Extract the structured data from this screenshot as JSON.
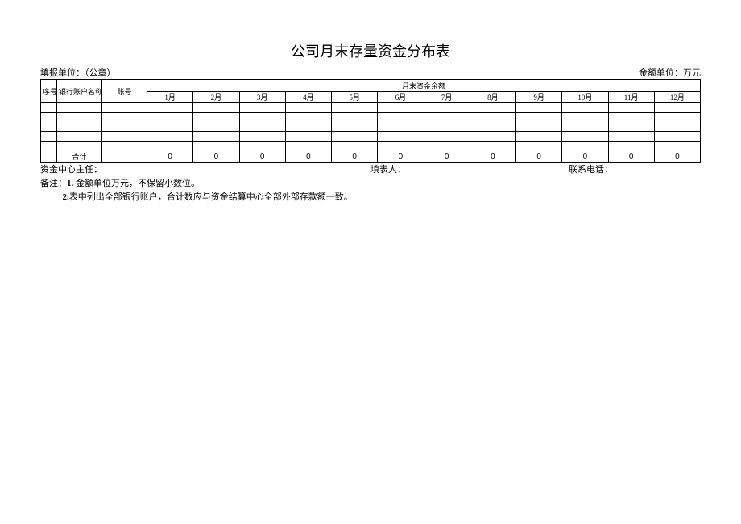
{
  "title": "公司月末存量资金分布表",
  "header": {
    "org_label": "填报单位：（公章）",
    "unit_label": "金额单位：万元"
  },
  "columns": {
    "seq": "序号",
    "bank_name": "银行账户名称",
    "account": "账号",
    "balance_header": "月末资金余额",
    "months": [
      "1月",
      "2月",
      "3月",
      "4月",
      "5月",
      "6月",
      "7月",
      "8月",
      "9月",
      "10月",
      "11月",
      "12月"
    ]
  },
  "rows": [
    {
      "seq": "",
      "name": "",
      "acct": "",
      "vals": [
        "",
        "",
        "",
        "",
        "",
        "",
        "",
        "",
        "",
        "",
        "",
        ""
      ]
    },
    {
      "seq": "",
      "name": "",
      "acct": "",
      "vals": [
        "",
        "",
        "",
        "",
        "",
        "",
        "",
        "",
        "",
        "",
        "",
        ""
      ]
    },
    {
      "seq": "",
      "name": "",
      "acct": "",
      "vals": [
        "",
        "",
        "",
        "",
        "",
        "",
        "",
        "",
        "",
        "",
        "",
        ""
      ]
    },
    {
      "seq": "",
      "name": "",
      "acct": "",
      "vals": [
        "",
        "",
        "",
        "",
        "",
        "",
        "",
        "",
        "",
        "",
        "",
        ""
      ]
    },
    {
      "seq": "",
      "name": "",
      "acct": "",
      "vals": [
        "",
        "",
        "",
        "",
        "",
        "",
        "",
        "",
        "",
        "",
        "",
        ""
      ]
    }
  ],
  "total": {
    "label": "合计",
    "vals": [
      "0",
      "0",
      "0",
      "0",
      "0",
      "0",
      "0",
      "0",
      "0",
      "0",
      "0",
      "0"
    ]
  },
  "footer": {
    "director": "资金中心主任：",
    "filler": "填表人：",
    "phone": "联系电话："
  },
  "notes": {
    "prefix": "备注：",
    "n1_b": "1.",
    "n1": " 金额单位万元，不保留小数位。",
    "n2_b": "2.",
    "n2": "表中列出全部银行账户，合计数应与资金结算中心全部外部存款额一致。"
  }
}
